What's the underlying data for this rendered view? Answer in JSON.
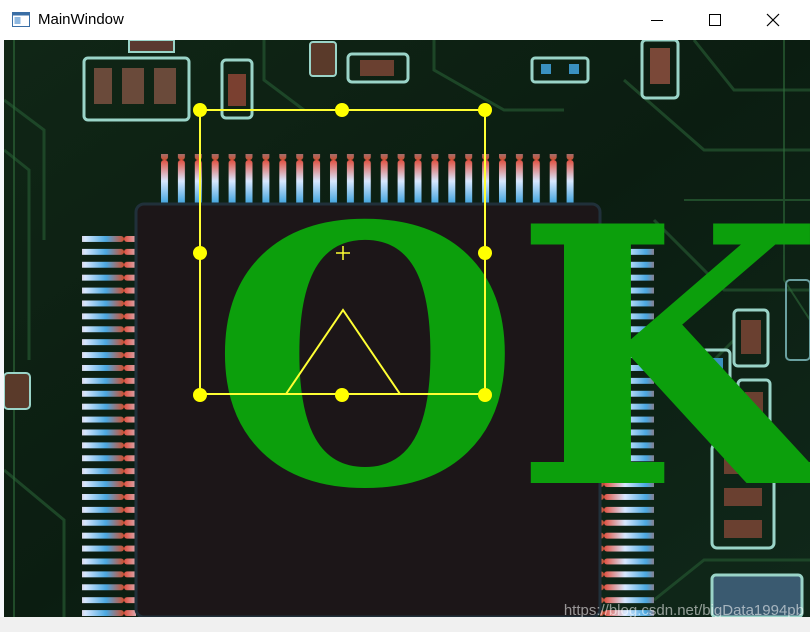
{
  "window": {
    "title": "MainWindow",
    "controls": [
      "minimize",
      "maximize",
      "close"
    ]
  },
  "canvas": {
    "background": "PCB microscope image with QFP chip",
    "overlay_text": "OK",
    "overlay_text_color": "#0c9f0c",
    "roi_color": "#ffff00",
    "watermark": "https://blog.csdn.net/bigData1994pb"
  },
  "icons": {
    "app": "window-app-icon",
    "minimize": "minimize-icon",
    "maximize": "maximize-icon",
    "close": "close-icon"
  }
}
